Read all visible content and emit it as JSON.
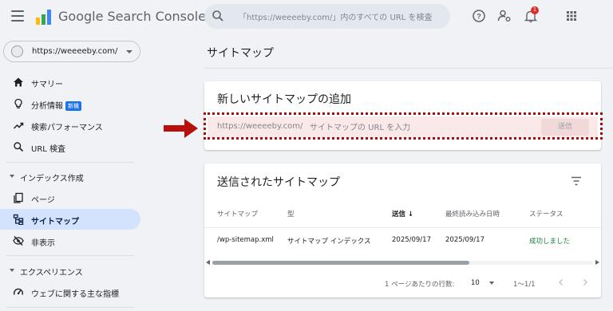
{
  "header": {
    "app_title": "Google Search Console",
    "search_placeholder": "「https://weeeeby.com/」内のすべての URL を検査",
    "notification_count": "1",
    "icons": [
      "menu-icon",
      "search-icon",
      "help-icon",
      "settings-people-icon",
      "notifications-icon",
      "apps-icon"
    ]
  },
  "property": {
    "label": "https://weeeeby.com/"
  },
  "sidebar": {
    "items": [
      {
        "label": "サマリー",
        "icon": "home-icon"
      },
      {
        "label": "分析情報",
        "icon": "lightbulb-icon",
        "badge": "新機"
      },
      {
        "label": "検索パフォーマンス",
        "icon": "trending-up-icon"
      },
      {
        "label": "URL 検査",
        "icon": "search-icon"
      }
    ],
    "section_index": "インデックス作成",
    "index_items": [
      {
        "label": "ページ",
        "icon": "pages-icon"
      },
      {
        "label": "サイトマップ",
        "icon": "sitemap-icon",
        "active": true
      },
      {
        "label": "非表示",
        "icon": "visibility-off-icon"
      }
    ],
    "section_experience": "エクスペリエンス",
    "experience_items": [
      {
        "label": "ウェブに関する主な指標",
        "icon": "speed-icon"
      }
    ]
  },
  "main": {
    "page_title": "サイトマップ",
    "add_card": {
      "title": "新しいサイトマップの追加",
      "prefix": "https://weeeeby.com/",
      "input_placeholder": "サイトマップの URL を入力",
      "submit_label": "送信"
    },
    "submitted_card": {
      "title": "送信されたサイトマップ",
      "columns": [
        "サイトマップ",
        "型",
        "送信",
        "最終読み込み日時",
        "ステータス"
      ],
      "sort_indicator": "↓",
      "rows": [
        [
          "/wp-sitemap.xml",
          "サイトマップ インデックス",
          "2025/09/17",
          "2025/09/17",
          "成功しました"
        ]
      ],
      "pager": {
        "rows_per_page_label": "1 ページあたりの行数:",
        "rows_per_page_value": "10",
        "range": "1〜1/1"
      }
    }
  },
  "colors": {
    "accent": "#1a73e8",
    "active_nav": "#d3e3fd",
    "highlight_border": "#a50e0e",
    "success": "#188038"
  }
}
